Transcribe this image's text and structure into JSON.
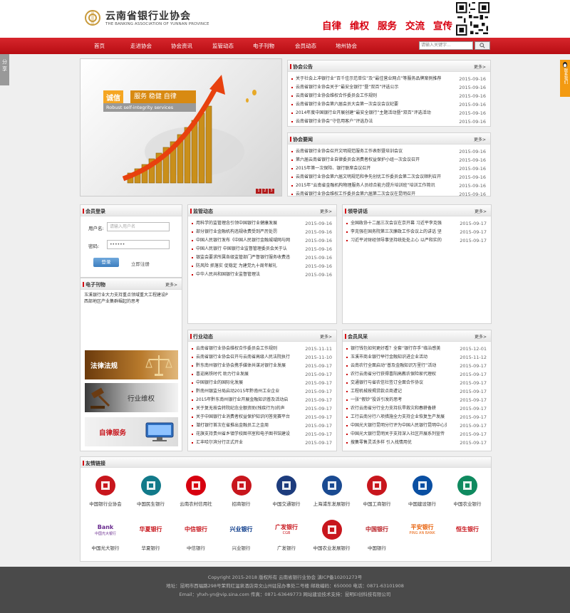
{
  "header": {
    "name_cn": "云南省银行业协会",
    "name_en": "THE BANKING ASSOCIATION OF YUNNAN PROVINCE",
    "slogans": [
      "自律",
      "维权",
      "服务",
      "交流",
      "宣传"
    ]
  },
  "nav": {
    "items": [
      "首页",
      "走进协会",
      "协会资讯",
      "监管动态",
      "电子刊物",
      "会员动态",
      "地州协会"
    ],
    "search_placeholder": "请输入关键字..."
  },
  "share_tab": "分享",
  "qq_tab": "联系我们",
  "banner": {
    "cheng": "诚信",
    "words": "服务 稳健 自律",
    "en": "Robust self-integrity services",
    "dots": [
      "1",
      "2",
      "3"
    ]
  },
  "notice": {
    "title": "协会公告",
    "more": "更多>",
    "items": [
      {
        "t": "关于社会上冲银行业“百千佳示范单位”及“最佳营业网点”等服务品牌案例推荐",
        "d": "2015-09-16"
      },
      {
        "t": "云南省银行业协会关于“最安全银行”暨“双百”评选公示",
        "d": "2015-09-16"
      },
      {
        "t": "云南省银行业协会维权合作委员会工作规则",
        "d": "2015-09-16"
      },
      {
        "t": "云南省银行业协会第六届会员大会第一次会议会议纪要",
        "d": "2015-09-16"
      },
      {
        "t": "2014年度中国银行业开展创建“最安全银行”主题活动暨“双百”评选活动",
        "d": "2015-09-16"
      },
      {
        "t": "云南省银行业协会“守信用客户”评选办法",
        "d": "2015-09-16"
      }
    ]
  },
  "assoc_news": {
    "title": "协会要闻",
    "more": "更多>",
    "items": [
      {
        "t": "云南省银行业协会召开文明规范服务工作表彰暨培训会议",
        "d": "2015-09-16"
      },
      {
        "t": "第六届云南省银行业自律委员会消费者权益保护小组一次会议召开",
        "d": "2015-09-16"
      },
      {
        "t": "2015年第一次保险、银行联席会议召开",
        "d": "2015-09-16"
      },
      {
        "t": "云南省银行业协会第六届文明规范和争先创优工作委员会第二次会议顺利召开",
        "d": "2015-09-16"
      },
      {
        "t": "2015年“云南省金融机构物理服务人员综合能力提升培训班”培训工作简讯",
        "d": "2015-09-16"
      },
      {
        "t": "云南省银行业协会维权工作委员会第六届第二次会议在昆明召开",
        "d": "2015-09-16"
      }
    ]
  },
  "login": {
    "title": "会员登录",
    "user_label": "用户名:",
    "user_placeholder": "请输入用户名",
    "pass_label": "密码:",
    "pass_placeholder": "••••••",
    "login_btn": "登录",
    "register": "立即注册"
  },
  "regulation": {
    "title": "监管动态",
    "more": "更多>",
    "items": [
      {
        "t": "用科学的监管理念引领中国银行业健康发展",
        "d": "2015-09-16"
      },
      {
        "t": "部分银行业金融机构违规收费受到严厉处罚",
        "d": "2015-09-16"
      },
      {
        "t": "中国人民银行发布《中国人民银行金融城域网与网",
        "d": "2015-09-16"
      },
      {
        "t": "中国人民银行 中国银行业监督管理委员会关于认",
        "d": "2015-09-16"
      },
      {
        "t": "银监会要求所属各级监管部门严督银行服务收费违",
        "d": "2015-09-16"
      },
      {
        "t": "防风险 抓落实 促稳定 为建党九十周年献礼",
        "d": "2015-09-16"
      },
      {
        "t": "中华人民共和国银行业监督管理法",
        "d": "2015-09-16"
      }
    ]
  },
  "leader": {
    "title": "领导讲话",
    "more": "更多>",
    "items": [
      {
        "t": "全国政协十二届三次会议在京开幕 习近平李克强",
        "d": "2015-09-17"
      },
      {
        "t": "李克强在国务院第三次廉政工作会议上的讲话 坚",
        "d": "2015-09-17"
      },
      {
        "t": "习近平对财经领导事坚持统处处上心 以严和实的",
        "d": "2015-09-17"
      }
    ]
  },
  "ebook": {
    "title": "电子刊物",
    "more": "更多>",
    "lines": [
      "玉溪银行业大力支持重点领域重大工程建设P",
      "西部地区产业集群崛起的思考"
    ]
  },
  "side_banners": [
    "法律法规",
    "行业维权",
    "自律服务"
  ],
  "industry": {
    "title": "行业动态",
    "more": "更多>",
    "items": [
      {
        "t": "云南省银行业协会维权合作委员会工作规则",
        "d": "2015-11-11"
      },
      {
        "t": "云南省银行业协会召开与云南省高级人民法院执行",
        "d": "2015-11-10"
      },
      {
        "t": "黔东南州银行业协会携手媒体共谋对银行业发展",
        "d": "2015-09-17"
      },
      {
        "t": "喜迎高铁时代 助力行业发展",
        "d": "2015-09-17"
      },
      {
        "t": "中国银行业的国际化发展",
        "d": "2015-09-17"
      },
      {
        "t": "黔南州银监分局启动2015年黔南州工业企业",
        "d": "2015-09-17"
      },
      {
        "t": "2015年黔东南州银行业开展金融知识普及活动启",
        "d": "2015-09-17"
      },
      {
        "t": "关于复无按会转院纪念全额资助(残疾行为)的声",
        "d": "2015-09-17"
      },
      {
        "t": "关于中国银行业消费者权益保护知识问答竞赛平台",
        "d": "2015-09-17"
      },
      {
        "t": "潜打银行首次在省推出金融员工之金周",
        "d": "2015-09-17"
      },
      {
        "t": "花旗支持贵州省乡镇学校图书室和电子图书馆建设",
        "d": "2015-09-17"
      },
      {
        "t": "汇丰哈尔滨分行正式开业",
        "d": "2015-09-17"
      }
    ]
  },
  "member": {
    "title": "会员风采",
    "more": "更多>",
    "items": [
      {
        "t": "银行钱包如何更好看？全套“银行存手”临治感美",
        "d": "2015-12-01"
      },
      {
        "t": "玉溪市商业银行举行金融知识进企业活动",
        "d": "2015-11-12"
      },
      {
        "t": "云南农行全面启动“普及金融知识万里行”活动",
        "d": "2015-09-17"
      },
      {
        "t": "农行云南省分行获得喜阳高教农保险家代理权",
        "d": "2015-09-17"
      },
      {
        "t": "交通银行与省农信社签订全面合作协议",
        "d": "2015-09-17"
      },
      {
        "t": "工程机械按揭贷款点商遭记",
        "d": "2015-09-17"
      },
      {
        "t": "一张“假钞”投诉引发的思考",
        "d": "2015-09-17"
      },
      {
        "t": "农行云南省分行全力支持抗旱救灾和春耕备耕",
        "d": "2015-09-17"
      },
      {
        "t": "工行云南分行八项措施全力支持企业恢复生产发展",
        "d": "2015-09-17"
      },
      {
        "t": "中国光大银行昆明分行评为中国人民银行昆明中心支",
        "d": "2015-09-17"
      },
      {
        "t": "中国光大银行昆明关于支持深入社区开展系列宣传",
        "d": "2015-09-17"
      },
      {
        "t": "搜集零售灵活多样 引入找情用优",
        "d": "2015-09-17"
      }
    ]
  },
  "links": {
    "title": "友情链接",
    "items": [
      {
        "name": "中国银行业协会",
        "icon": "cba-logo",
        "color": "#c8161d"
      },
      {
        "name": "中国民生银行",
        "icon": "cmbc-logo",
        "color": "#127a8a"
      },
      {
        "name": "云南农村信用社",
        "icon": "rcc-logo",
        "color": "#d7000f"
      },
      {
        "name": "招商银行",
        "icon": "cmb-logo",
        "color": "#c8161d"
      },
      {
        "name": "中国交通银行",
        "icon": "bocom-logo",
        "color": "#1d3c7d"
      },
      {
        "name": "上海浦东发展银行",
        "icon": "spdb-logo",
        "color": "#1a4a91"
      },
      {
        "name": "中国工商银行",
        "icon": "icbc-logo",
        "color": "#c8161d"
      },
      {
        "name": "中国建设银行",
        "icon": "ccb-logo",
        "color": "#0a4fa2"
      },
      {
        "name": "中国农业银行",
        "icon": "abc-logo",
        "color": "#0f8a5f"
      },
      {
        "name": "中国光大银行",
        "icon": "ceb-logo",
        "color": "#6a2c8f",
        "mark": "Bank",
        "sub": "中国光大银行"
      },
      {
        "name": "华夏银行",
        "icon": "hxb-logo",
        "color": "#c8161d",
        "mark": "华夏银行"
      },
      {
        "name": "中信银行",
        "icon": "citic-logo",
        "color": "#c8161d",
        "mark": "中信银行"
      },
      {
        "name": "兴业银行",
        "icon": "cib-logo",
        "color": "#0a3a8a",
        "mark": "兴业银行"
      },
      {
        "name": "广发银行",
        "icon": "cgb-logo",
        "color": "#c8161d",
        "mark": "广发银行",
        "sub": "CGB"
      },
      {
        "name": "中国农业发展银行",
        "icon": "adbc-logo",
        "color": "#c8161d"
      },
      {
        "name": "中国银行",
        "icon": "boc-logo",
        "color": "#b81c22",
        "mark": "中国银行"
      },
      {
        "name": "",
        "icon": "pingan-logo",
        "color": "#e8620c",
        "mark": "平安银行",
        "sub": "PING AN BANK"
      },
      {
        "name": "",
        "icon": "hs-logo",
        "color": "#c8161d",
        "mark": "恒生银行"
      }
    ]
  },
  "footer": {
    "line1": "Copyright 2015-2018 版权所有   云南省银行业协会   滇ICP备10201273号",
    "line2": "地址：昆明市西福路298号茉莉红温泉酒店旁文山州驻昆办事处二号楼   邮政编码：650000   电话：0871-63101908",
    "line3": "Email：yhxh-yn@vip.sina.com   传真：0871-63649773   网站建设技术支持：昆明EI创科技有限公司"
  }
}
